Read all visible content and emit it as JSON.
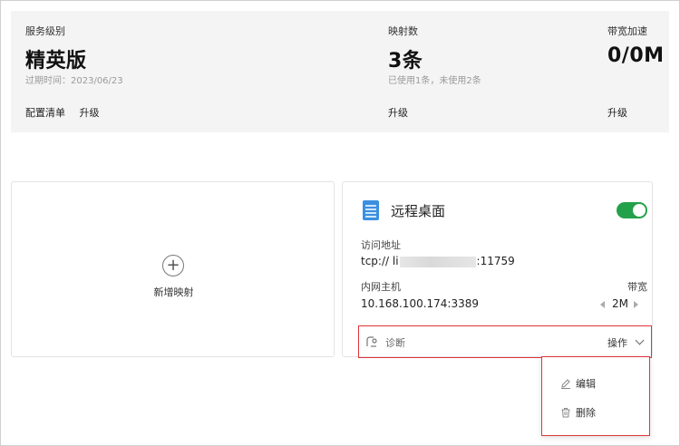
{
  "summary": {
    "service": {
      "label": "服务级别",
      "value": "精英版",
      "expiry": "过期时间：2023/06/23",
      "links": [
        "配置清单",
        "升级"
      ]
    },
    "mappings": {
      "label": "映射数",
      "value": "3条",
      "usage": "已使用1条，未使用2条",
      "link": "升级"
    },
    "bandwidth": {
      "label": "带宽加速",
      "value": "0/0M",
      "link": "升级"
    }
  },
  "add_card": {
    "label": "新增映射"
  },
  "desktop_card": {
    "title": "远程桌面",
    "enabled": true,
    "access_label": "访问地址",
    "access_prefix": "tcp:// li",
    "access_suffix": ":11759",
    "host_label": "内网主机",
    "host_value": "10.168.100.174:3389",
    "bandwidth_label": "带宽",
    "bandwidth_value": "2M",
    "diagnose_label": "诊断",
    "operations_label": "操作"
  },
  "menu": {
    "items": [
      {
        "label": "编辑",
        "icon": "edit-icon"
      },
      {
        "label": "删除",
        "icon": "trash-icon"
      }
    ]
  },
  "colors": {
    "toggle_on": "#22a14a",
    "highlight_border": "#e0353a",
    "app_icon": "#3b8fe0"
  }
}
